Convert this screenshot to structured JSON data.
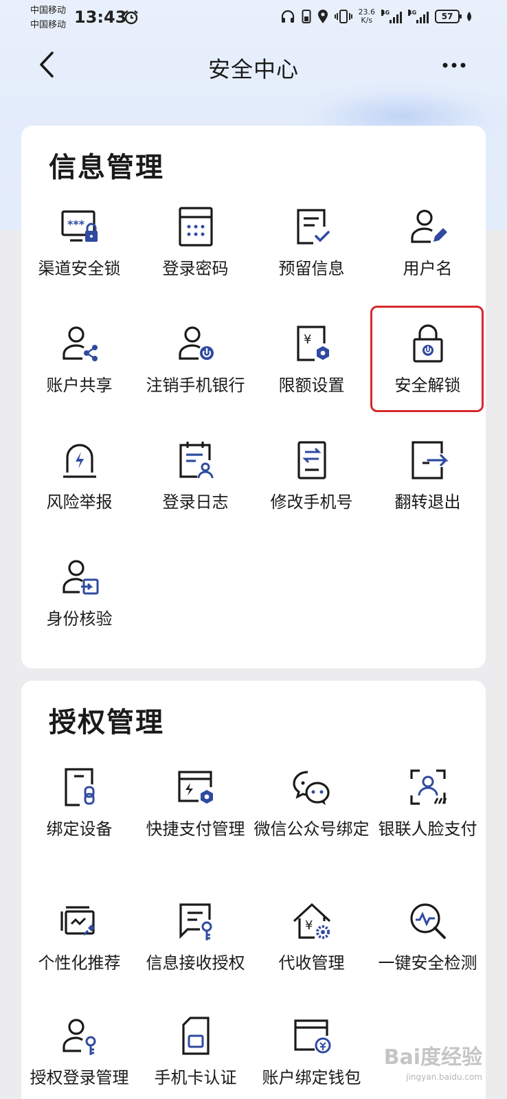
{
  "status_bar": {
    "carrier_1": "中国移动",
    "carrier_2": "中国移动",
    "time": "13:43",
    "net_speed_value": "23.6",
    "net_speed_unit": "K/s",
    "signal_tag_1": "4G",
    "signal_tag_2": "4G",
    "battery": "57"
  },
  "nav": {
    "title": "安全中心"
  },
  "info_section": {
    "title": "信息管理",
    "items": [
      {
        "label": "渠道安全锁",
        "icon": "screen-lock-icon"
      },
      {
        "label": "登录密码",
        "icon": "password-keypad-icon"
      },
      {
        "label": "预留信息",
        "icon": "document-check-icon"
      },
      {
        "label": "用户名",
        "icon": "user-edit-icon"
      },
      {
        "label": "账户共享",
        "icon": "user-share-icon"
      },
      {
        "label": "注销手机银行",
        "icon": "user-power-icon"
      },
      {
        "label": "限额设置",
        "icon": "yuan-limit-icon"
      },
      {
        "label": "安全解锁",
        "icon": "padlock-unlock-icon"
      },
      {
        "label": "风险举报",
        "icon": "risk-alarm-icon"
      },
      {
        "label": "登录日志",
        "icon": "log-user-icon"
      },
      {
        "label": "修改手机号",
        "icon": "phone-swap-icon"
      },
      {
        "label": "翻转退出",
        "icon": "exit-icon"
      },
      {
        "label": "身份核验",
        "icon": "identity-verify-icon"
      }
    ]
  },
  "auth_section": {
    "title": "授权管理",
    "items": [
      {
        "label": "绑定设备",
        "icon": "device-bind-icon"
      },
      {
        "label": "快捷支付管理",
        "icon": "quick-pay-icon"
      },
      {
        "label": "微信公众号绑定",
        "icon": "wechat-icon"
      },
      {
        "label": "银联人脸支付",
        "icon": "face-pay-icon"
      },
      {
        "label": "个性化推荐",
        "icon": "recommend-icon"
      },
      {
        "label": "信息接收授权",
        "icon": "message-key-icon"
      },
      {
        "label": "代收管理",
        "icon": "collection-house-icon"
      },
      {
        "label": "一键安全检测",
        "icon": "security-scan-icon"
      },
      {
        "label": "授权登录管理",
        "icon": "auth-login-icon"
      },
      {
        "label": "手机卡认证",
        "icon": "sim-card-icon"
      },
      {
        "label": "账户绑定钱包",
        "icon": "wallet-bind-icon"
      }
    ]
  },
  "watermark": {
    "brand": "Bai度经验",
    "url": "jingyan.baidu.com"
  },
  "colors": {
    "icon_dark": "#1a1a1a",
    "icon_accent": "#2f4aa0",
    "highlight": "#d6282c"
  }
}
